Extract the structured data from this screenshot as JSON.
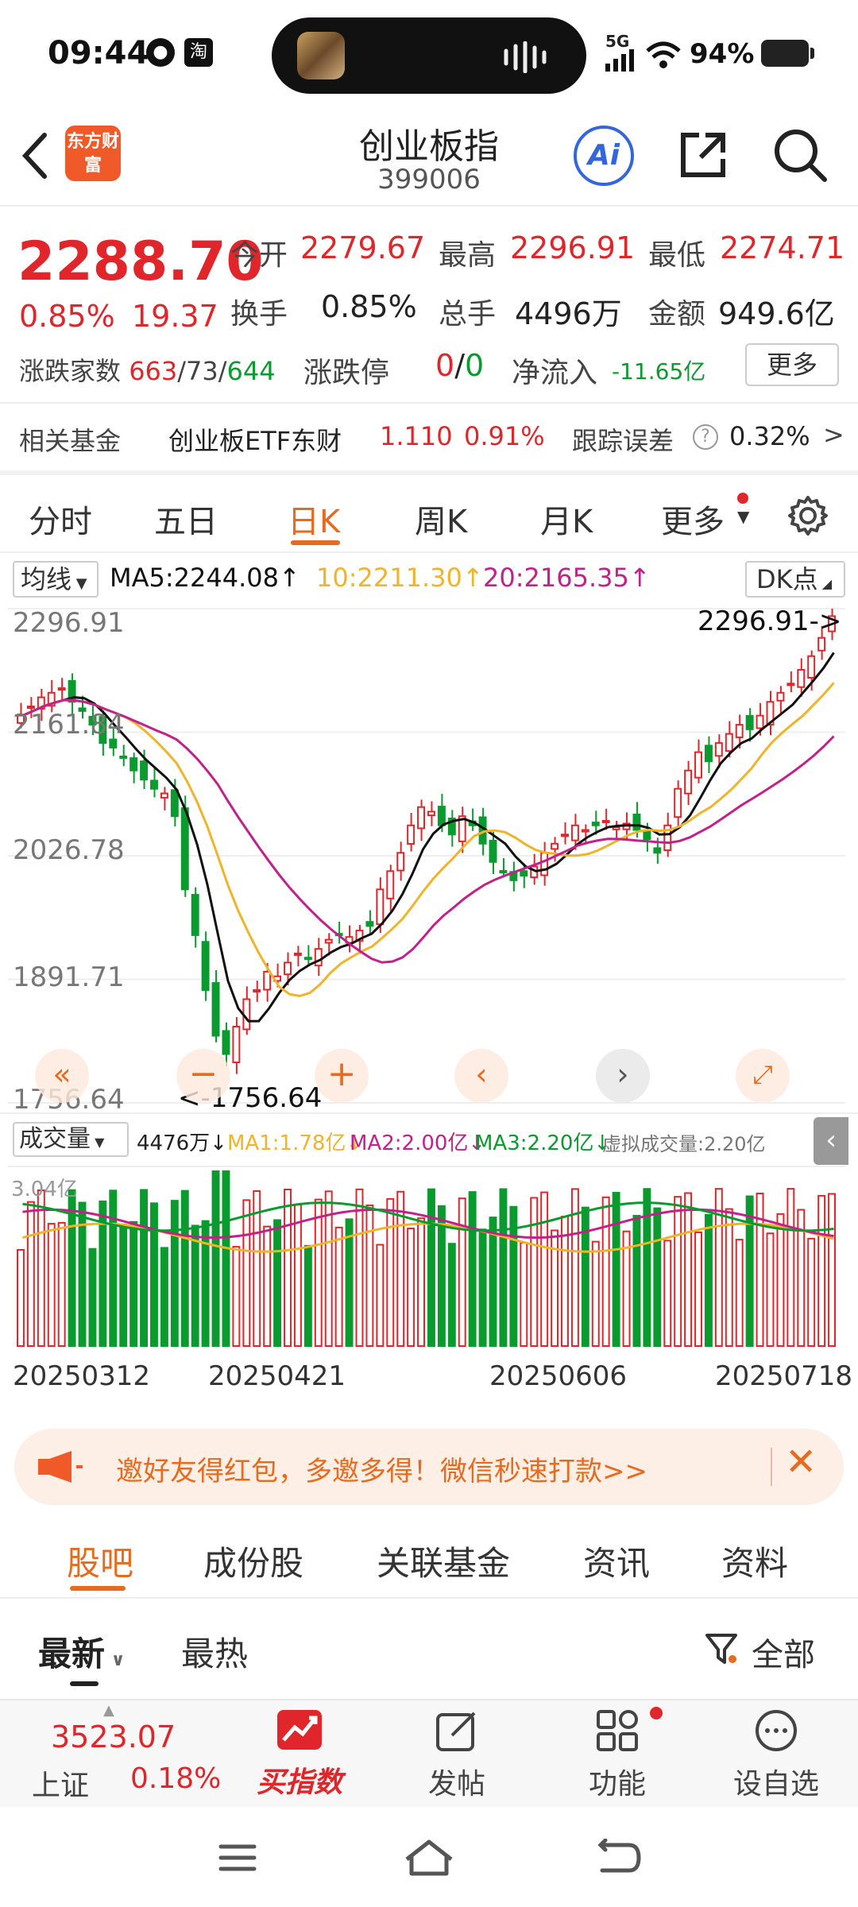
{
  "status_bar": {
    "time": "09:44",
    "network": "5G",
    "battery_percent": "94%",
    "icons": [
      "app-notification-icon",
      "taobao-icon",
      "signal-icon",
      "wifi-icon",
      "battery-icon"
    ]
  },
  "header": {
    "back_icon": "back-arrow-icon",
    "logo_text": "东方财富",
    "title": "创业板指",
    "code": "399006",
    "ai_label": "Ai",
    "share_icon": "share-icon",
    "search_icon": "search-icon"
  },
  "quote": {
    "price": "2288.70",
    "change_pct": "0.85%",
    "change": "19.37",
    "open_label": "今开",
    "open": "2279.67",
    "high_label": "最高",
    "high": "2296.91",
    "low_label": "最低",
    "low": "2274.71",
    "turnover_label": "换手",
    "turnover": "0.85%",
    "volume_label": "总手",
    "volume": "4496万",
    "amount_label": "金额",
    "amount": "949.6亿",
    "breadth_label": "涨跌家数",
    "up_count": "663",
    "flat_count": "73",
    "down_count": "644",
    "limit_label": "涨跌停",
    "limit_up": "0",
    "limit_down": "0",
    "netflow_label": "净流入",
    "netflow": "-11.65亿",
    "more_button": "更多"
  },
  "fund_row": {
    "label": "相关基金",
    "fund_name": "创业板ETF东财",
    "fund_price": "1.110",
    "fund_pct": "0.91%",
    "error_label": "跟踪误差",
    "error_value": "0.32%"
  },
  "chart_tabs": [
    "分时",
    "五日",
    "日K",
    "周K",
    "月K",
    "更多"
  ],
  "chart_tab_active": 2,
  "ma_bar": {
    "indicator": "均线",
    "ma5": "MA5:2244.08↑",
    "ma10": "10:2211.30↑",
    "ma20": "20:2165.35↑",
    "dk_button": "DK点"
  },
  "chart_data": {
    "type": "candlestick",
    "y_ticks": [
      "2296.91",
      "2161.84",
      "2026.78",
      "1891.71",
      "1756.64"
    ],
    "ylim": [
      1756.64,
      2296.91
    ],
    "max_marker": "2296.91->",
    "min_marker": "<-1756.64",
    "x_ticks": [
      "20250312",
      "20250421",
      "20250606",
      "20250718"
    ],
    "close_series": [
      2180,
      2190,
      2200,
      2205,
      2210,
      2195,
      2185,
      2170,
      2150,
      2145,
      2135,
      2120,
      2110,
      2100,
      2095,
      2070,
      1990,
      1940,
      1880,
      1830,
      1810,
      1840,
      1870,
      1880,
      1900,
      1895,
      1910,
      1920,
      1915,
      1925,
      1935,
      1940,
      1938,
      1945,
      1950,
      1990,
      2010,
      2030,
      2060,
      2080,
      2075,
      2060,
      2050,
      2070,
      2060,
      2040,
      2020,
      2010,
      2000,
      2005,
      2015,
      2030,
      2040,
      2050,
      2060,
      2055,
      2060,
      2065,
      2058,
      2062,
      2055,
      2045,
      2030,
      2060,
      2100,
      2120,
      2140,
      2130,
      2150,
      2160,
      2170,
      2165,
      2180,
      2195,
      2205,
      2215,
      2230,
      2245,
      2265,
      2288.7
    ],
    "ma5": "2244.08",
    "ma10": "2211.30",
    "ma20": "2165.35",
    "volume": {
      "label": "成交量",
      "value": "4476万↓",
      "ma1": "MA1:1.78亿↓",
      "ma2": "MA2:2.00亿↓",
      "ma3": "MA3:2.20亿↓",
      "virtual": "虚拟成交量:2.20亿",
      "top_tick": "3.04亿"
    }
  },
  "chart_controls": [
    "rewind-icon",
    "zoom-in-icon",
    "prev-icon",
    "next-icon",
    "fullscreen-icon"
  ],
  "banner": {
    "text": "邀好友得红包，多邀多得！微信秒速打款>>"
  },
  "bottom_tabs": [
    "股吧",
    "成份股",
    "关联基金",
    "资讯",
    "资料"
  ],
  "bottom_tab_active": 0,
  "filter": {
    "latest": "最新",
    "hot": "最热",
    "all": "全部"
  },
  "dock": {
    "index_value": "3523.07",
    "index_name": "上证",
    "index_pct": "0.18%",
    "buy_label": "买指数",
    "post_label": "发帖",
    "func_label": "功能",
    "watch_label": "设自选"
  },
  "colors": {
    "up": "#e0262b",
    "down": "#0a9b2f",
    "accent": "#e86a1c",
    "ma5": "#111111",
    "ma10": "#f0b429",
    "ma20": "#c4208a"
  }
}
